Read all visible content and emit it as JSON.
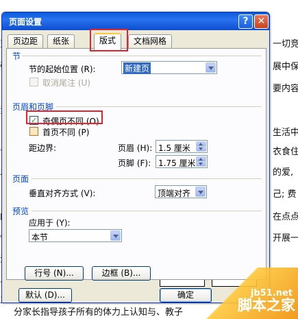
{
  "background_text": {
    "left": [
      "变心",
      "强研",
      "　自",
      "素社",
      "目",
      "让",
      "发",
      "自",
      "的自",
      "惶",
      "浴",
      "、",
      "主"
    ],
    "right": [
      "一切竞",
      "展中保",
      "要内容",
      "生活中",
      "衣食住",
      "的爱,",
      "己; 费",
      "在点点",
      "开展一"
    ],
    "bottom": "分家长指导孩子所有的体力上认知与、教子"
  },
  "dialog": {
    "title": "页面设置",
    "help_glyph": "?",
    "close_glyph": "✕",
    "tabs": [
      "页边距",
      "纸张",
      "版式",
      "文档网格"
    ],
    "active_tab": "版式"
  },
  "section": {
    "heading": "节",
    "start_label": "节的起始位置 (R):",
    "start_value": "新建页",
    "suppress_endnotes_label": "取消尾注 (U)"
  },
  "header_footer": {
    "heading": "页眉和页脚",
    "odd_even_label": "奇偶页不同 (O)",
    "first_page_label": "首页不同 (P)",
    "from_edge_label": "距边界:",
    "header_label": "页眉 (H):",
    "header_value": "1.5 厘米",
    "footer_label": "页脚 (F):",
    "footer_value": "1.75 厘米"
  },
  "page": {
    "heading": "页面",
    "valign_label": "垂直对齐方式 (V):",
    "valign_value": "顶端对齐"
  },
  "preview": {
    "heading": "预览",
    "apply_label": "应用于 (Y):",
    "apply_value": "本节"
  },
  "buttons": {
    "line_numbers": "行号 (N)...",
    "borders": "边框 (B)...",
    "default": "默认 (D)...",
    "ok": "确定"
  },
  "watermark": {
    "url": "jb51.net",
    "name": "脚本之家"
  },
  "colors": {
    "accent": "#0046d5",
    "highlight_box": "#e5232d"
  }
}
